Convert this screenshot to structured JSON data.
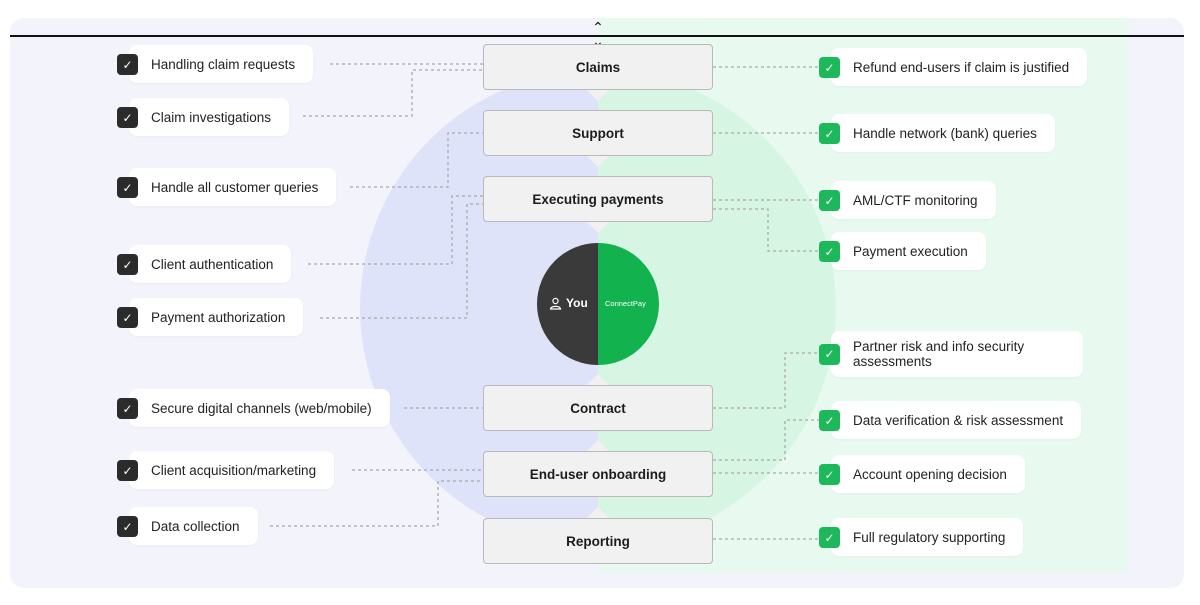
{
  "center": {
    "you_label": "You",
    "partner_label": "ConnectPay"
  },
  "boxes": [
    "Claims",
    "Support",
    "Executing payments",
    "Contract",
    "End-user onboarding",
    "Reporting"
  ],
  "left_items": [
    "Handling claim requests",
    "Claim investigations",
    "Handle all customer queries",
    "Client authentication",
    "Payment authorization",
    "Secure digital channels (web/mobile)",
    "Client acquisition/marketing",
    "Data collection"
  ],
  "right_items": [
    "Refund end-users if claim is justified",
    "Handle network (bank) queries",
    "AML/CTF monitoring",
    "Payment execution",
    "Partner risk and info security assessments",
    "Data verification & risk assessment",
    "Account opening decision",
    "Full regulatory supporting"
  ],
  "icons": {
    "check": "check-icon",
    "user": "user-icon",
    "handle": "collapse-handle-icon"
  },
  "colors": {
    "dark_check": "#2b2b2b",
    "green_check": "#1cb85a",
    "you_half": "#3a3a3a",
    "partner_half": "#12b24f"
  }
}
